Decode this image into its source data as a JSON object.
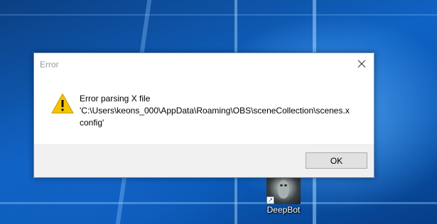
{
  "dialog": {
    "title": "Error",
    "message_lines": [
      "Error parsing X file",
      "'C:\\Users\\keons_000\\AppData\\Roaming\\OBS\\sceneCollection\\scenes.x",
      "config'"
    ],
    "ok_label": "OK",
    "icon": "warning-icon",
    "warning_color": "#f5c400"
  },
  "desktop": {
    "shortcut": {
      "label": "DeepBot",
      "icon": "deepbot-app-icon"
    }
  }
}
